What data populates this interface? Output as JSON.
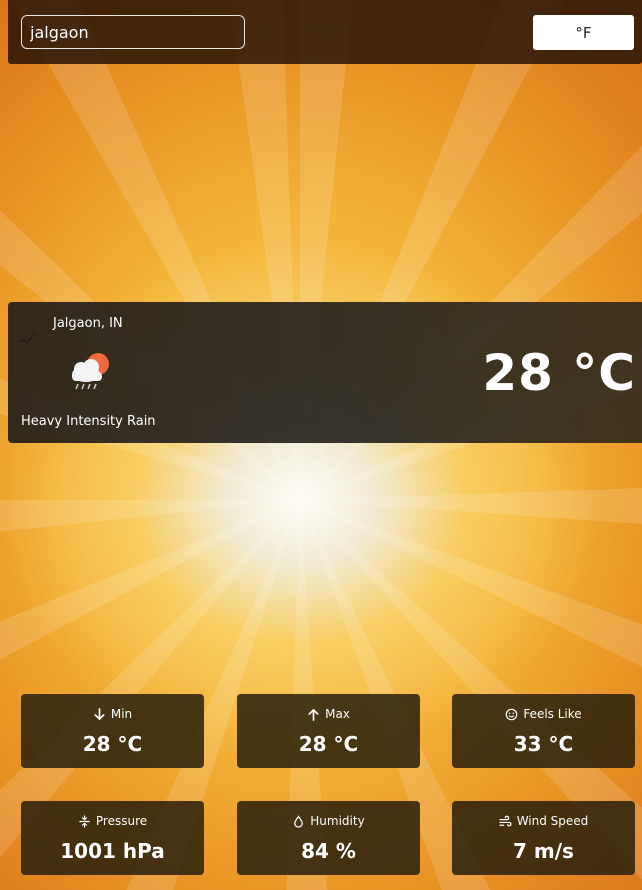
{
  "search": {
    "value": "jalgaon",
    "placeholder": ""
  },
  "unit_toggle": {
    "label": "°F"
  },
  "current": {
    "location": "Jalgaon, IN",
    "condition": "Heavy Intensity Rain",
    "temperature": "28 °C",
    "icon": "cloud-rain-sun-icon"
  },
  "stats": {
    "min": {
      "label": "Min",
      "value": "28 °C",
      "icon": "arrow-down-icon"
    },
    "max": {
      "label": "Max",
      "value": "28 °C",
      "icon": "arrow-up-icon"
    },
    "feels_like": {
      "label": "Feels Like",
      "value": "33 °C",
      "icon": "smiley-icon"
    },
    "pressure": {
      "label": "Pressure",
      "value": "1001 hPa",
      "icon": "compress-icon"
    },
    "humidity": {
      "label": "Humidity",
      "value": "84 %",
      "icon": "droplet-icon"
    },
    "wind_speed": {
      "label": "Wind Speed",
      "value": "7 m/s",
      "icon": "wind-icon"
    }
  },
  "colors": {
    "panel": "#231e19",
    "accent_sun": "#e98a2a"
  }
}
